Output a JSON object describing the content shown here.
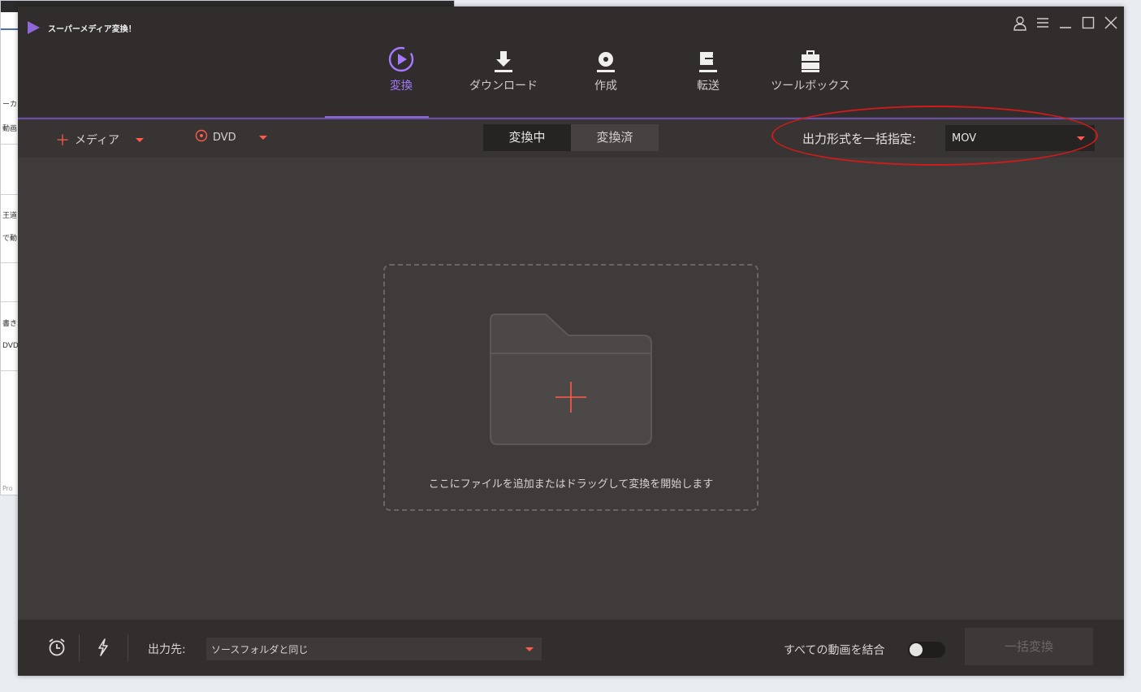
{
  "background_window": {
    "fragments": [
      "ーカ",
      "動画",
      "王道",
      "で動",
      "書き",
      "DVDに",
      "Pro"
    ]
  },
  "app": {
    "title": "スーパーメディア変換！",
    "window_controls": [
      "user-icon",
      "menu-icon",
      "minimize-icon",
      "maximize-icon",
      "close-icon"
    ]
  },
  "nav": {
    "tabs": [
      {
        "label": "変換",
        "icon": "convert-icon",
        "active": true
      },
      {
        "label": "ダウンロード",
        "icon": "download-icon",
        "active": false
      },
      {
        "label": "作成",
        "icon": "disc-burn-icon",
        "active": false
      },
      {
        "label": "転送",
        "icon": "transfer-icon",
        "active": false
      },
      {
        "label": "ツールボックス",
        "icon": "toolbox-icon",
        "active": false
      }
    ]
  },
  "toolbar": {
    "add_media_plus": "＋",
    "add_media_label": "メディア",
    "dvd_label": "DVD",
    "seg_converting": "変換中",
    "seg_converted": "変換済",
    "format_label": "出力形式を一括指定:",
    "format_value": "MOV"
  },
  "dropzone": {
    "text": "ここにファイルを追加またはドラッグして変換を開始します"
  },
  "footer": {
    "output_label": "出力先:",
    "output_value": "ソースフォルダと同じ",
    "merge_label": "すべての動画を結合",
    "merge_enabled": false,
    "convert_all_label": "一括変換"
  },
  "colors": {
    "accent_purple": "#a679ff",
    "accent_red": "#ff5a4a",
    "annotation_red": "#d11a1a"
  }
}
